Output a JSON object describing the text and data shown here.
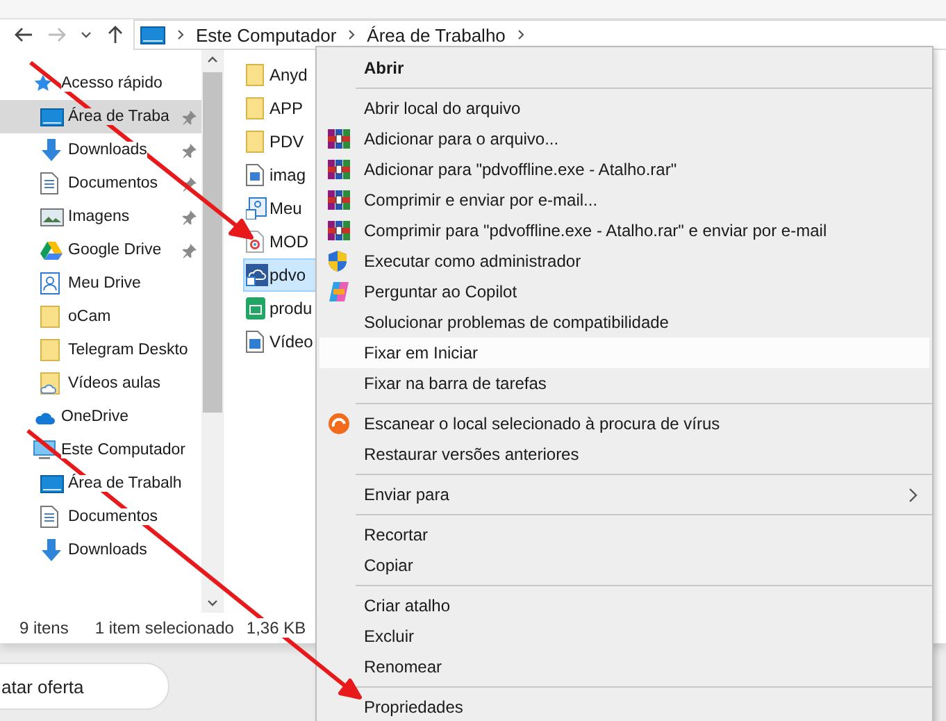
{
  "address_bar": {
    "back_enabled": true,
    "forward_enabled": false,
    "crumbs": [
      "Este Computador",
      "Área de Trabalho"
    ]
  },
  "navigation": [
    {
      "label": "Acesso rápido",
      "kind": "star",
      "selected": false,
      "children": [
        {
          "label": "Área de Traba",
          "kind": "desktop",
          "selected": true,
          "pinned": true
        },
        {
          "label": "Downloads",
          "kind": "download",
          "selected": false,
          "pinned": true
        },
        {
          "label": "Documentos",
          "kind": "document",
          "selected": false,
          "pinned": true
        },
        {
          "label": "Imagens",
          "kind": "images",
          "selected": false,
          "pinned": true
        },
        {
          "label": "Google Drive",
          "kind": "gdrive",
          "selected": false,
          "pinned": true
        },
        {
          "label": "Meu Drive",
          "kind": "drive",
          "selected": false,
          "pinned": false
        },
        {
          "label": "oCam",
          "kind": "folder",
          "selected": false,
          "pinned": false
        },
        {
          "label": "Telegram Deskto",
          "kind": "folder",
          "selected": false,
          "pinned": false
        },
        {
          "label": "Vídeos aulas",
          "kind": "cloudfolder",
          "selected": false,
          "pinned": false
        }
      ]
    },
    {
      "label": "OneDrive",
      "kind": "onedrive",
      "selected": false
    },
    {
      "label": "Este Computador",
      "kind": "computer",
      "selected": false,
      "children": [
        {
          "label": "Área de Trabalh",
          "kind": "desktop",
          "selected": false,
          "pinned": false
        },
        {
          "label": "Documentos",
          "kind": "document",
          "selected": false,
          "pinned": false
        },
        {
          "label": "Downloads",
          "kind": "download",
          "selected": false,
          "pinned": false
        }
      ]
    }
  ],
  "files": [
    {
      "name": "Anyd",
      "kind": "folder",
      "selected": false
    },
    {
      "name": "APP",
      "kind": "folder",
      "selected": false
    },
    {
      "name": "PDV",
      "kind": "folder",
      "selected": false
    },
    {
      "name": "imag",
      "kind": "image",
      "selected": false
    },
    {
      "name": "Meu",
      "kind": "shortcut",
      "selected": false
    },
    {
      "name": "MOD",
      "kind": "chrome",
      "selected": false
    },
    {
      "name": "pdvo",
      "kind": "cloudshortcut",
      "selected": true
    },
    {
      "name": "produ",
      "kind": "sheet",
      "selected": false
    },
    {
      "name": "Vídeo",
      "kind": "video",
      "selected": false
    }
  ],
  "status_bar": {
    "count": "9 itens",
    "selection": "1 item selecionado",
    "size": "1,36 KB"
  },
  "offer_button": "atar oferta",
  "context_menu": [
    {
      "kind": "bold",
      "label": "Abrir",
      "selected": false
    },
    {
      "kind": "separator"
    },
    {
      "kind": "plain",
      "label": "Abrir local do arquivo",
      "selected": false
    },
    {
      "kind": "archive",
      "label": "Adicionar para o arquivo...",
      "selected": false
    },
    {
      "kind": "archive",
      "label": "Adicionar para \"pdvoffline.exe - Atalho.rar\"",
      "selected": false
    },
    {
      "kind": "archive",
      "label": "Comprimir e enviar por e-mail...",
      "selected": false
    },
    {
      "kind": "archive",
      "label": "Comprimir para \"pdvoffline.exe - Atalho.rar\" e enviar por e-mail",
      "selected": false
    },
    {
      "kind": "shield",
      "label": "Executar como administrador",
      "selected": false
    },
    {
      "kind": "copilot",
      "label": "Perguntar ao Copilot",
      "selected": false
    },
    {
      "kind": "plain",
      "label": "Solucionar problemas de compatibilidade",
      "selected": false
    },
    {
      "kind": "plain",
      "label": "Fixar em Iniciar",
      "selected": true
    },
    {
      "kind": "plain",
      "label": "Fixar na barra de tarefas",
      "selected": false
    },
    {
      "kind": "separator"
    },
    {
      "kind": "scan",
      "label": "Escanear o local selecionado à procura de vírus",
      "selected": false
    },
    {
      "kind": "plain",
      "label": "Restaurar versões anteriores",
      "selected": false
    },
    {
      "kind": "separator"
    },
    {
      "kind": "submenu",
      "label": "Enviar para",
      "selected": false
    },
    {
      "kind": "separator"
    },
    {
      "kind": "plain",
      "label": "Recortar",
      "selected": false
    },
    {
      "kind": "plain",
      "label": "Copiar",
      "selected": false
    },
    {
      "kind": "separator"
    },
    {
      "kind": "plain",
      "label": "Criar atalho",
      "selected": false
    },
    {
      "kind": "plain",
      "label": "Excluir",
      "selected": false
    },
    {
      "kind": "plain",
      "label": "Renomear",
      "selected": false
    },
    {
      "kind": "separator"
    },
    {
      "kind": "plain",
      "label": "Propriedades",
      "selected": false
    }
  ]
}
